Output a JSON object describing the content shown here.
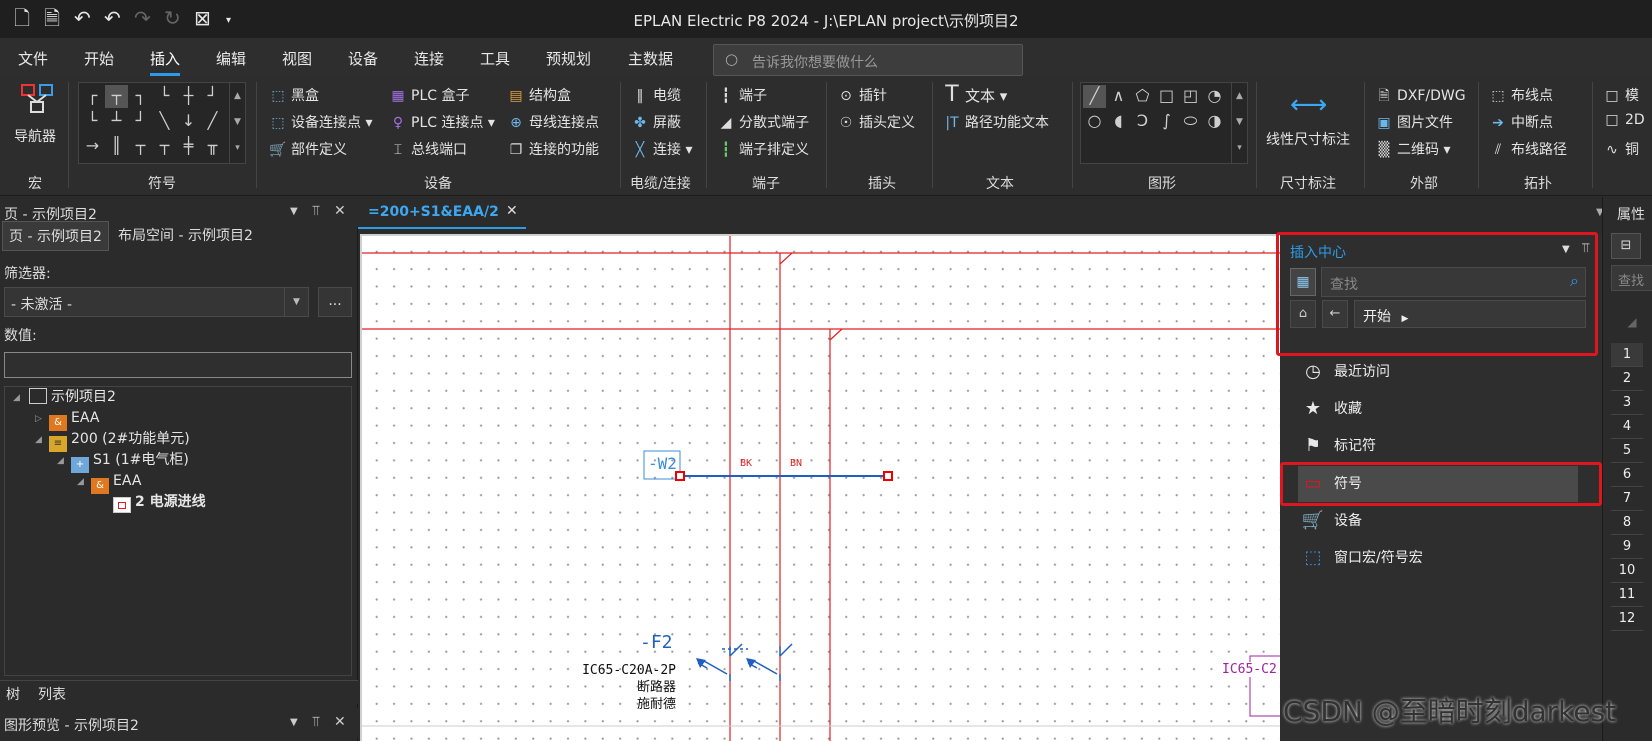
{
  "window": {
    "title": "EPLAN Electric P8 2024 - J:\\EPLAN project\\示例项目2"
  },
  "quick_access": [
    "new-page-icon",
    "new-doc-icon",
    "undo-icon",
    "undo-step-icon",
    "redo-icon",
    "redo-step-icon",
    "select-icon",
    "dropdown-icon"
  ],
  "menu": {
    "items": [
      "文件",
      "开始",
      "插入",
      "编辑",
      "视图",
      "设备",
      "连接",
      "工具",
      "预规划",
      "主数据"
    ],
    "active": "插入",
    "search_placeholder": "告诉我你想要做什么"
  },
  "ribbon": {
    "groups": {
      "macro": "宏",
      "symbol": "符号",
      "device": "设备",
      "cable": "电缆/连接",
      "terminal": "端子",
      "plug": "插头",
      "text": "文本",
      "graphic": "图形",
      "dimension": "尺寸标注",
      "external": "外部",
      "topology": "拓扑"
    },
    "navigator": "导航器",
    "device_items": [
      "黑盒",
      "设备连接点",
      "部件定义",
      "PLC 盒子",
      "PLC 连接点",
      "总线端口",
      "结构盒",
      "母线连接点",
      "连接的功能"
    ],
    "cable_items": [
      "电缆",
      "屏蔽",
      "连接"
    ],
    "terminal_items": [
      "端子",
      "分散式端子",
      "端子排定义"
    ],
    "plug_items": [
      "插针",
      "插头定义"
    ],
    "text_items": [
      "文本",
      "路径功能文本"
    ],
    "dimension_item": "线性尺寸标注",
    "external_items": [
      "DXF/DWG",
      "图片文件",
      "二维码"
    ],
    "topology_items": [
      "布线点",
      "中断点",
      "布线路径"
    ],
    "cut_items": [
      "模",
      "2D",
      "铜"
    ]
  },
  "left_panel": {
    "header": "页 - 示例项目2",
    "tabs": [
      "页 - 示例项目2",
      "布局空间 - 示例项目2"
    ],
    "filter_label": "筛选器:",
    "filter_value": "- 未激活 -",
    "filter_more": "...",
    "value_label": "数值:",
    "tree": [
      {
        "label": "示例项目2",
        "level": 0
      },
      {
        "label": "EAA",
        "level": 1
      },
      {
        "label": "200 (2#功能单元)",
        "level": 1
      },
      {
        "label": "S1 (1#电气柜)",
        "level": 2
      },
      {
        "label": "EAA",
        "level": 3
      },
      {
        "label": "2 电源进线",
        "level": 4
      }
    ],
    "bottom_tabs": [
      "树",
      "列表"
    ],
    "preview_header": "图形预览 - 示例项目2"
  },
  "document_tab": {
    "label": "=200+S1&EAA/2"
  },
  "schematic": {
    "cable_tag": "-W2",
    "wire_labels": [
      "BK",
      "BN"
    ],
    "breaker_tag": "-F2",
    "breaker_lines": [
      "IC65-C20A-2P",
      "断路器",
      "施耐德"
    ],
    "right_tag": "IC65-C2"
  },
  "insert_center": {
    "title": "插入中心",
    "search_placeholder": "查找",
    "breadcrumb": "开始",
    "items": [
      "最近访问",
      "收藏",
      "标记符",
      "符号",
      "设备",
      "窗口宏/符号宏"
    ],
    "selected": "符号"
  },
  "right_panel": {
    "header": "属性",
    "search": "查找",
    "rows": [
      "1",
      "2",
      "3",
      "4",
      "5",
      "6",
      "7",
      "8",
      "9",
      "10",
      "11",
      "12"
    ]
  },
  "watermark": "CSDN @至暗时刻darkest",
  "colors": {
    "accent": "#2c9be8",
    "highlight": "#e0161e",
    "wire_red": "#e02020",
    "wire_blue": "#1f5fbf"
  }
}
